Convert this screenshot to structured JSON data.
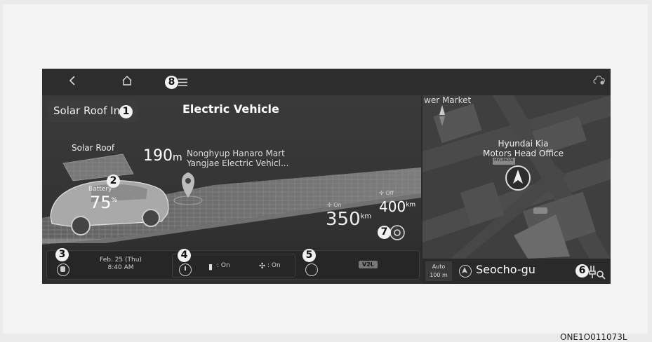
{
  "topbar": {
    "back_icon": "chevron-left-icon",
    "home_icon": "home-icon",
    "menu_icon": "menu-icon",
    "menu_badge": "8",
    "settings_icon": "cloud-gear-icon"
  },
  "left": {
    "solar_button_label": "Solar Roof In",
    "solar_badge": "1",
    "title": "Electric Vehicle",
    "solar_roof_label": "Solar Roof",
    "battery_badge": "2",
    "battery_label": "Battery",
    "battery_value": "75",
    "battery_unit": "%",
    "distance_value": "190",
    "distance_unit": "m",
    "poi_line1": "Nonghyup Hanaro Mart",
    "poi_line2": "Yangjae Electric Vehicl...",
    "range_off_label": "Off",
    "range_off_value": "400",
    "range_on_label": "On",
    "range_on_value": "350",
    "range_unit": "km",
    "settings_badge": "7"
  },
  "bottom": {
    "charge_badge": "3",
    "date": "Feb. 25 (Thu)",
    "time": "8:40  AM",
    "schedule_badge": "4",
    "plug_status": ": On",
    "fan_status": ": On",
    "v2l_badge": "5",
    "v2l_label": "V2L"
  },
  "map": {
    "market_label": "wer Market",
    "poi_label_1": "Hyundai Kia",
    "poi_label_2": "Motors Head Office",
    "brand_label": "HYUNDAI",
    "auto_label": "Auto",
    "scale_label": "100 m",
    "location": "Seocho-gu",
    "charge_search_badge": "6"
  },
  "footer_code": "ONE1O011073L"
}
